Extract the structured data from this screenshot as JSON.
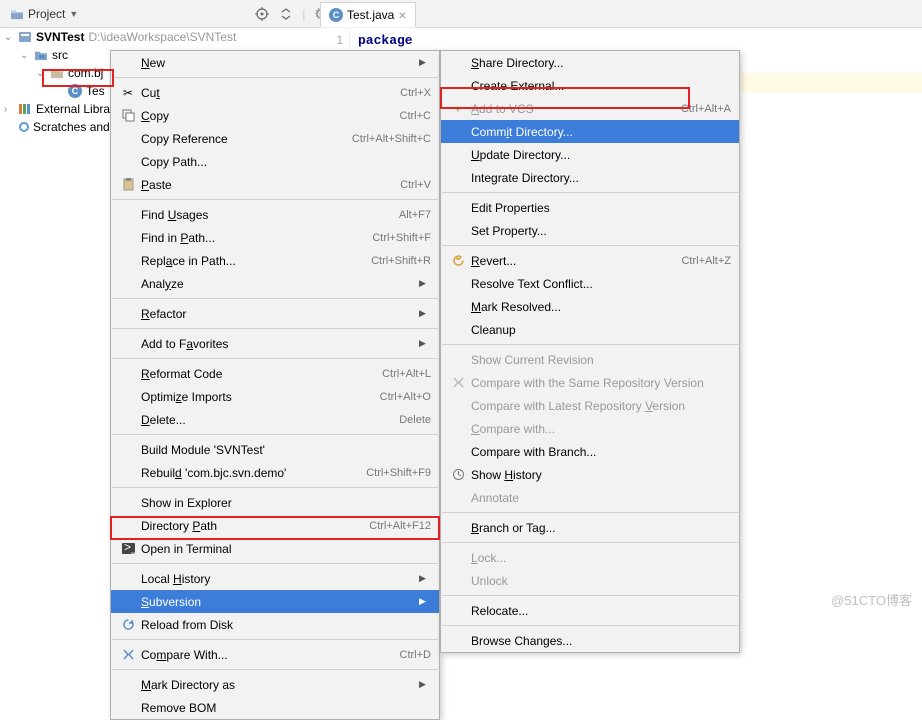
{
  "toolbar": {
    "project_label": "Project",
    "tab": {
      "filename": "Test.java"
    },
    "line_number": "1",
    "code_keyword": "package"
  },
  "tree": {
    "root_name": "SVNTest",
    "root_path": "D:\\ideaWorkspace\\SVNTest",
    "src": "src",
    "pkg": "com.bj",
    "file": "Tes",
    "ext_lib": "External Libra",
    "scratches": "Scratches and"
  },
  "menu1": {
    "new": "New",
    "cut": "Cut",
    "cut_sc": "Ctrl+X",
    "copy": "Copy",
    "copy_sc": "Ctrl+C",
    "copy_ref": "Copy Reference",
    "copy_ref_sc": "Ctrl+Alt+Shift+C",
    "copy_path": "Copy Path...",
    "paste": "Paste",
    "paste_sc": "Ctrl+V",
    "find_usages": "Find Usages",
    "find_usages_sc": "Alt+F7",
    "find_in_path": "Find in Path...",
    "find_in_path_sc": "Ctrl+Shift+F",
    "replace_in_path": "Replace in Path...",
    "replace_in_path_sc": "Ctrl+Shift+R",
    "analyze": "Analyze",
    "refactor": "Refactor",
    "add_fav": "Add to Favorites",
    "reformat": "Reformat Code",
    "reformat_sc": "Ctrl+Alt+L",
    "optimize": "Optimize Imports",
    "optimize_sc": "Ctrl+Alt+O",
    "delete": "Delete...",
    "delete_sc": "Delete",
    "build_module": "Build Module 'SVNTest'",
    "rebuild": "Rebuild 'com.bjc.svn.demo'",
    "rebuild_sc": "Ctrl+Shift+F9",
    "show_explorer": "Show in Explorer",
    "dir_path": "Directory Path",
    "dir_path_sc": "Ctrl+Alt+F12",
    "open_terminal": "Open in Terminal",
    "local_history": "Local History",
    "subversion": "Subversion",
    "reload": "Reload from Disk",
    "compare_with": "Compare With...",
    "compare_with_sc": "Ctrl+D",
    "mark_dir": "Mark Directory as",
    "remove_bom": "Remove BOM"
  },
  "menu2": {
    "share_dir": "Share Directory...",
    "create_ext": "Create External...",
    "add_vcs": "Add to VCS",
    "add_vcs_sc": "Ctrl+Alt+A",
    "commit_dir": "Commit Directory...",
    "update_dir": "Update Directory...",
    "integrate_dir": "Integrate Directory...",
    "edit_props": "Edit Properties",
    "set_prop": "Set Property...",
    "revert": "Revert...",
    "revert_sc": "Ctrl+Alt+Z",
    "resolve": "Resolve Text Conflict...",
    "mark_resolved": "Mark Resolved...",
    "cleanup": "Cleanup",
    "show_revision": "Show Current Revision",
    "compare_same": "Compare with the Same Repository Version",
    "compare_latest": "Compare with Latest Repository Version",
    "compare_with": "Compare with...",
    "compare_branch": "Compare with Branch...",
    "show_history": "Show History",
    "annotate": "Annotate",
    "branch_tag": "Branch or Tag...",
    "lock": "Lock...",
    "unlock": "Unlock",
    "relocate": "Relocate...",
    "browse_changes": "Browse Changes..."
  },
  "watermark": "@51CTO博客"
}
